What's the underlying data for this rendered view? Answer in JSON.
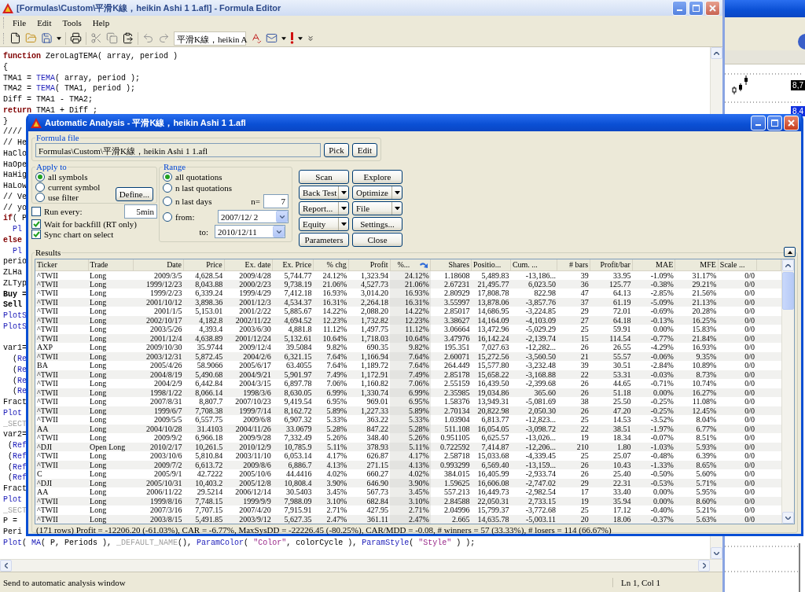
{
  "editor": {
    "title": "[Formulas\\Custom\\平滑K線，heikin Ashi 1 1.afl] - Formula Editor",
    "menu": [
      "File",
      "Edit",
      "Tools",
      "Help"
    ],
    "toolbar_combo": "平滑K線，heikin A",
    "code_lines": [
      {
        "segments": [
          {
            "kind": "keyword",
            "text": "function"
          },
          {
            "kind": "plain",
            "text": " ZeroLagTEMA( array, period )"
          }
        ]
      },
      {
        "segments": [
          {
            "kind": "plain",
            "text": "{"
          }
        ]
      },
      {
        "segments": [
          {
            "kind": "plain",
            "text": "TMA1 = "
          },
          {
            "kind": "func",
            "text": "TEMA"
          },
          {
            "kind": "plain",
            "text": "( array, period );"
          }
        ]
      },
      {
        "segments": [
          {
            "kind": "plain",
            "text": "TMA2 = "
          },
          {
            "kind": "func",
            "text": "TEMA"
          },
          {
            "kind": "plain",
            "text": "( TMA1, period );"
          }
        ]
      },
      {
        "segments": [
          {
            "kind": "plain",
            "text": "Diff = TMA1 - TMA2;"
          }
        ]
      },
      {
        "segments": [
          {
            "kind": "keyword",
            "text": "return"
          },
          {
            "kind": "plain",
            "text": " TMA1 + Diff ;"
          }
        ]
      },
      {
        "segments": [
          {
            "kind": "plain",
            "text": "}"
          }
        ]
      },
      {
        "segments": [
          {
            "kind": "plain",
            "text": "////"
          }
        ]
      },
      {
        "segments": [
          {
            "kind": "plain",
            "text": "// He"
          }
        ]
      },
      {
        "segments": [
          {
            "kind": "plain",
            "text": "HaClo"
          }
        ]
      },
      {
        "segments": [
          {
            "kind": "plain",
            "text": "HaOpe"
          }
        ]
      },
      {
        "segments": [
          {
            "kind": "plain",
            "text": "HaHig"
          }
        ]
      },
      {
        "segments": [
          {
            "kind": "plain",
            "text": "HaLow"
          }
        ]
      },
      {
        "segments": [
          {
            "kind": "plain",
            "text": "// Ve"
          }
        ]
      },
      {
        "segments": [
          {
            "kind": "plain",
            "text": "// yo"
          }
        ]
      },
      {
        "segments": [
          {
            "kind": "keyword",
            "text": "if"
          },
          {
            "kind": "plain",
            "text": "( P"
          }
        ]
      },
      {
        "indented": true,
        "segments": [
          {
            "kind": "func",
            "text": "Pl"
          }
        ]
      },
      {
        "segments": [
          {
            "kind": "keyword",
            "text": "else"
          }
        ]
      },
      {
        "indented": true,
        "segments": [
          {
            "kind": "func",
            "text": "Pl"
          }
        ]
      },
      {
        "segments": [
          {
            "kind": "plain",
            "text": "perio"
          }
        ]
      },
      {
        "segments": [
          {
            "kind": "plain",
            "text": "ZLHa"
          }
        ]
      },
      {
        "segments": [
          {
            "kind": "plain",
            "text": "ZLTyp"
          }
        ]
      },
      {
        "segments": [
          {
            "kind": "bold",
            "text": "Buy ="
          }
        ]
      },
      {
        "segments": [
          {
            "kind": "bold",
            "text": "Sell"
          }
        ]
      },
      {
        "segments": [
          {
            "kind": "func",
            "text": "PlotS"
          }
        ]
      },
      {
        "segments": [
          {
            "kind": "func",
            "text": "PlotS"
          }
        ]
      },
      {
        "kind": "blank"
      },
      {
        "segments": [
          {
            "kind": "plain",
            "text": "var1="
          }
        ]
      },
      {
        "segments": [
          {
            "kind": "plain",
            "text": "  ("
          },
          {
            "kind": "func",
            "text": "Re"
          }
        ]
      },
      {
        "segments": [
          {
            "kind": "plain",
            "text": "  ("
          },
          {
            "kind": "func",
            "text": "Re"
          }
        ]
      },
      {
        "segments": [
          {
            "kind": "plain",
            "text": "  ("
          },
          {
            "kind": "func",
            "text": "Re"
          }
        ]
      },
      {
        "segments": [
          {
            "kind": "plain",
            "text": "  ("
          },
          {
            "kind": "func",
            "text": "Re"
          }
        ]
      },
      {
        "segments": [
          {
            "kind": "plain",
            "text": "Fract"
          }
        ]
      },
      {
        "segments": [
          {
            "kind": "func",
            "text": "Plot"
          }
        ]
      },
      {
        "segments": [
          {
            "kind": "muted",
            "text": "_SECT"
          }
        ]
      },
      {
        "segments": [
          {
            "kind": "plain",
            "text": "var2="
          }
        ]
      },
      {
        "segments": [
          {
            "kind": "plain",
            "text": " ("
          },
          {
            "kind": "func",
            "text": "Ref"
          }
        ]
      },
      {
        "segments": [
          {
            "kind": "plain",
            "text": " ("
          },
          {
            "kind": "func",
            "text": "Ref"
          }
        ]
      },
      {
        "segments": [
          {
            "kind": "plain",
            "text": " ("
          },
          {
            "kind": "func",
            "text": "Ref"
          }
        ]
      },
      {
        "segments": [
          {
            "kind": "plain",
            "text": " ("
          },
          {
            "kind": "func",
            "text": "Ref"
          }
        ]
      },
      {
        "segments": [
          {
            "kind": "plain",
            "text": "Fract"
          }
        ]
      },
      {
        "segments": [
          {
            "kind": "func",
            "text": "Plot"
          }
        ]
      },
      {
        "segments": [
          {
            "kind": "muted",
            "text": "_SECT"
          }
        ]
      },
      {
        "segments": [
          {
            "kind": "plain",
            "text": "P = "
          }
        ]
      },
      {
        "segments": [
          {
            "kind": "plain",
            "text": "Peri"
          }
        ]
      },
      {
        "segments": [
          {
            "kind": "func",
            "text": "Plot"
          },
          {
            "kind": "plain",
            "text": "( "
          },
          {
            "kind": "func",
            "text": "MA"
          },
          {
            "kind": "plain",
            "text": "( P, Periods ), "
          },
          {
            "kind": "muted",
            "text": "_DEFAULT_NAME"
          },
          {
            "kind": "plain",
            "text": "(), "
          },
          {
            "kind": "func",
            "text": "ParamColor"
          },
          {
            "kind": "plain",
            "text": "( "
          },
          {
            "kind": "string",
            "text": "\"Color\""
          },
          {
            "kind": "plain",
            "text": ", colorCycle ), "
          },
          {
            "kind": "func",
            "text": "ParamStyle"
          },
          {
            "kind": "plain",
            "text": "( "
          },
          {
            "kind": "string",
            "text": "\"Style\""
          },
          {
            "kind": "plain",
            "text": " ) );"
          }
        ]
      }
    ],
    "status": "Send to automatic analysis window",
    "position": "Ln 1, Col 1"
  },
  "chart_panel": {
    "price_labels": [
      {
        "text": "8,7",
        "kind": "last"
      },
      {
        "text": "8,4",
        "kind": "current"
      }
    ]
  },
  "dialog": {
    "title": "Automatic Analysis - 平滑K線，heikin Ashi 1 1.afl",
    "formula_file": {
      "label": "Formula file",
      "value": "Formulas\\Custom\\平滑K線，heikin Ashi 1 1.afl",
      "buttons": [
        "Pick",
        "Edit"
      ]
    },
    "apply_to": {
      "label": "Apply to",
      "options": [
        {
          "label": "all symbols",
          "selected": true
        },
        {
          "label": "current symbol",
          "selected": false
        },
        {
          "label": "use filter",
          "selected": false
        }
      ],
      "define_button": "Define..."
    },
    "run_every": {
      "label": "Run every:",
      "checked": false,
      "value": "5min"
    },
    "checkboxes": [
      {
        "label": "Wait for backfill (RT only)",
        "checked": true
      },
      {
        "label": "Sync chart on select",
        "checked": true
      }
    ],
    "range": {
      "label": "Range",
      "options": [
        {
          "label": "all quotations",
          "selected": true
        },
        {
          "label": "n last quotations",
          "selected": false
        },
        {
          "label": "n last days",
          "selected": false
        },
        {
          "label": "from:",
          "selected": false
        }
      ],
      "n_label": "n=",
      "n_value": "7",
      "from_date": "2007/12/ 2",
      "to_label": "to:",
      "to_date": "2010/12/11"
    },
    "actions": [
      {
        "label": "Scan",
        "dropdown": false
      },
      {
        "label": "Explore",
        "dropdown": false
      },
      {
        "label": "Back Test",
        "dropdown": true
      },
      {
        "label": "Optimize",
        "dropdown": true
      },
      {
        "label": "Report...",
        "dropdown": true
      },
      {
        "label": "File",
        "dropdown": true
      },
      {
        "label": "Equity",
        "dropdown": true
      },
      {
        "label": "Settings...",
        "dropdown": false
      },
      {
        "label": "Parameters",
        "dropdown": false
      },
      {
        "label": "Close",
        "dropdown": false
      }
    ],
    "results": {
      "label": "Results",
      "columns": [
        {
          "label": "Ticker",
          "sorted": false
        },
        {
          "label": "Trade",
          "sorted": false
        },
        {
          "label": "Date",
          "sorted": false
        },
        {
          "label": "Price",
          "sorted": false
        },
        {
          "label": "Ex. date",
          "sorted": false
        },
        {
          "label": "Ex. Price",
          "sorted": false
        },
        {
          "label": "% chg",
          "sorted": false
        },
        {
          "label": "Profit",
          "sorted": false
        },
        {
          "label": "%...",
          "sorted": true
        },
        {
          "label": "Shares",
          "sorted": false
        },
        {
          "label": "Positio...",
          "sorted": false
        },
        {
          "label": "Cum. ...",
          "sorted": false
        },
        {
          "label": "# bars",
          "sorted": false
        },
        {
          "label": "Profit/bar",
          "sorted": false
        },
        {
          "label": "MAE",
          "sorted": false
        },
        {
          "label": "MFE",
          "sorted": false
        },
        {
          "label": "Scale ...",
          "sorted": false
        }
      ],
      "rows": [
        [
          "^TWII",
          "Long",
          "2009/3/5",
          "4,628.54",
          "2009/4/28",
          "5,744.77",
          "24.12%",
          "1,323.94",
          "24.12%",
          "1.18608",
          "5,489.83",
          "-13,186...",
          "39",
          "33.95",
          "-1.09%",
          "31.17%",
          "0/0"
        ],
        [
          "^TWII",
          "Long",
          "1999/12/23",
          "8,043.88",
          "2000/2/23",
          "9,738.19",
          "21.06%",
          "4,527.73",
          "21.06%",
          "2.67231",
          "21,495.77",
          "6,023.50",
          "36",
          "125.77",
          "-0.38%",
          "29.21%",
          "0/0"
        ],
        [
          "^TWII",
          "Long",
          "1999/2/23",
          "6,339.24",
          "1999/4/29",
          "7,412.18",
          "16.93%",
          "3,014.20",
          "16.93%",
          "2.80929",
          "17,808.78",
          "822.98",
          "47",
          "64.13",
          "-2.85%",
          "21.56%",
          "0/0"
        ],
        [
          "^TWII",
          "Long",
          "2001/10/12",
          "3,898.36",
          "2001/12/3",
          "4,534.37",
          "16.31%",
          "2,264.18",
          "16.31%",
          "3.55997",
          "13,878.06",
          "-3,857.76",
          "37",
          "61.19",
          "-5.09%",
          "21.13%",
          "0/0"
        ],
        [
          "^TWII",
          "Long",
          "2001/1/5",
          "5,153.01",
          "2001/2/22",
          "5,885.67",
          "14.22%",
          "2,088.20",
          "14.22%",
          "2.85017",
          "14,686.95",
          "-3,224.85",
          "29",
          "72.01",
          "-0.69%",
          "20.28%",
          "0/0"
        ],
        [
          "^TWII",
          "Long",
          "2002/10/17",
          "4,182.8",
          "2002/11/22",
          "4,694.52",
          "12.23%",
          "1,732.82",
          "12.23%",
          "3.38627",
          "14,164.09",
          "-4,103.09",
          "27",
          "64.18",
          "-0.13%",
          "16.25%",
          "0/0"
        ],
        [
          "^TWII",
          "Long",
          "2003/5/26",
          "4,393.4",
          "2003/6/30",
          "4,881.8",
          "11.12%",
          "1,497.75",
          "11.12%",
          "3.06664",
          "13,472.96",
          "-5,029.29",
          "25",
          "59.91",
          "0.00%",
          "15.83%",
          "0/0"
        ],
        [
          "^TWII",
          "Long",
          "2001/12/4",
          "4,638.89",
          "2001/12/24",
          "5,132.61",
          "10.64%",
          "1,718.03",
          "10.64%",
          "3.47976",
          "16,142.24",
          "-2,139.74",
          "15",
          "114.54",
          "-0.77%",
          "21.84%",
          "0/0"
        ],
        [
          "AXP",
          "Long",
          "2009/10/30",
          "35.9744",
          "2009/12/4",
          "39.5084",
          "9.82%",
          "690.35",
          "9.82%",
          "195.351",
          "7,027.63",
          "-12,282...",
          "26",
          "26.55",
          "-4.29%",
          "16.93%",
          "0/0"
        ],
        [
          "^TWII",
          "Long",
          "2003/12/31",
          "5,872.45",
          "2004/2/6",
          "6,321.15",
          "7.64%",
          "1,166.94",
          "7.64%",
          "2.60071",
          "15,272.56",
          "-3,560.50",
          "21",
          "55.57",
          "-0.06%",
          "9.35%",
          "0/0"
        ],
        [
          "BA",
          "Long",
          "2005/4/26",
          "58.9066",
          "2005/6/17",
          "63.4055",
          "7.64%",
          "1,189.72",
          "7.64%",
          "264.449",
          "15,577.80",
          "-3,232.48",
          "39",
          "30.51",
          "-2.84%",
          "10.89%",
          "0/0"
        ],
        [
          "^TWII",
          "Long",
          "2004/8/19",
          "5,490.68",
          "2004/9/21",
          "5,901.97",
          "7.49%",
          "1,172.91",
          "7.49%",
          "2.85178",
          "15,658.22",
          "-3,168.88",
          "22",
          "53.31",
          "-0.03%",
          "8.73%",
          "0/0"
        ],
        [
          "^TWII",
          "Long",
          "2004/2/9",
          "6,442.84",
          "2004/3/15",
          "6,897.78",
          "7.06%",
          "1,160.82",
          "7.06%",
          "2.55159",
          "16,439.50",
          "-2,399.68",
          "26",
          "44.65",
          "-0.71%",
          "10.74%",
          "0/0"
        ],
        [
          "^TWII",
          "Long",
          "1998/1/22",
          "8,066.14",
          "1998/3/6",
          "8,630.05",
          "6.99%",
          "1,330.74",
          "6.99%",
          "2.35985",
          "19,034.86",
          "365.60",
          "26",
          "51.18",
          "0.00%",
          "16.27%",
          "0/0"
        ],
        [
          "^TWII",
          "Long",
          "2007/8/31",
          "8,807.7",
          "2007/10/23",
          "9,419.54",
          "6.95%",
          "969.01",
          "6.95%",
          "1.58376",
          "13,949.31",
          "-5,081.69",
          "38",
          "25.50",
          "-0.25%",
          "11.08%",
          "0/0"
        ],
        [
          "^TWII",
          "Long",
          "1999/6/7",
          "7,708.38",
          "1999/7/14",
          "8,162.72",
          "5.89%",
          "1,227.33",
          "5.89%",
          "2.70134",
          "20,822.98",
          "2,050.30",
          "26",
          "47.20",
          "-0.25%",
          "12.45%",
          "0/0"
        ],
        [
          "^TWII",
          "Long",
          "2009/5/5",
          "6,557.75",
          "2009/6/8",
          "6,907.32",
          "5.33%",
          "363.22",
          "5.33%",
          "1.03904",
          "6,813.77",
          "-12,823...",
          "25",
          "14.53",
          "-3.52%",
          "8.04%",
          "0/0"
        ],
        [
          "AA",
          "Long",
          "2004/10/28",
          "31.4103",
          "2004/11/26",
          "33.0679",
          "5.28%",
          "847.22",
          "5.28%",
          "511.108",
          "16,054.05",
          "-3,098.72",
          "22",
          "38.51",
          "-1.97%",
          "6.77%",
          "0/0"
        ],
        [
          "^TWII",
          "Long",
          "2009/9/2",
          "6,966.18",
          "2009/9/28",
          "7,332.49",
          "5.26%",
          "348.40",
          "5.26%",
          "0.951105",
          "6,625.57",
          "-13,026...",
          "19",
          "18.34",
          "-0.07%",
          "8.51%",
          "0/0"
        ],
        [
          "^DJI",
          "Open Long",
          "2010/2/17",
          "10,261.5",
          "2010/12/9",
          "10,785.9",
          "5.11%",
          "378.93",
          "5.11%",
          "0.722592",
          "7,414.87",
          "-12,206...",
          "210",
          "1.80",
          "-1.03%",
          "5.93%",
          "0/0"
        ],
        [
          "^TWII",
          "Long",
          "2003/10/6",
          "5,810.84",
          "2003/11/10",
          "6,053.14",
          "4.17%",
          "626.87",
          "4.17%",
          "2.58718",
          "15,033.68",
          "-4,339.45",
          "25",
          "25.07",
          "-0.48%",
          "6.39%",
          "0/0"
        ],
        [
          "^TWII",
          "Long",
          "2009/7/2",
          "6,613.72",
          "2009/8/6",
          "6,886.7",
          "4.13%",
          "271.15",
          "4.13%",
          "0.993299",
          "6,569.40",
          "-13,159...",
          "26",
          "10.43",
          "-1.33%",
          "8.65%",
          "0/0"
        ],
        [
          "C",
          "Long",
          "2005/9/1",
          "42.7222",
          "2005/10/6",
          "44.4416",
          "4.02%",
          "660.27",
          "4.02%",
          "384.015",
          "16,405.99",
          "-2,933.74",
          "26",
          "25.40",
          "-0.50%",
          "5.60%",
          "0/0"
        ],
        [
          "^DJI",
          "Long",
          "2005/10/31",
          "10,403.2",
          "2005/12/8",
          "10,808.4",
          "3.90%",
          "646.90",
          "3.90%",
          "1.59625",
          "16,606.08",
          "-2,747.02",
          "29",
          "22.31",
          "-0.53%",
          "5.71%",
          "0/0"
        ],
        [
          "AA",
          "Long",
          "2006/11/22",
          "29.5214",
          "2006/12/14",
          "30.5403",
          "3.45%",
          "567.73",
          "3.45%",
          "557.213",
          "16,449.73",
          "-2,982.54",
          "17",
          "33.40",
          "0.00%",
          "5.95%",
          "0/0"
        ],
        [
          "^TWII",
          "Long",
          "1999/8/16",
          "7,748.15",
          "1999/9/9",
          "7,988.09",
          "3.10%",
          "682.84",
          "3.10%",
          "2.84588",
          "22,050.31",
          "2,733.15",
          "19",
          "35.94",
          "0.00%",
          "8.60%",
          "0/0"
        ],
        [
          "^TWII",
          "Long",
          "2007/3/16",
          "7,707.15",
          "2007/4/20",
          "7,915.91",
          "2.71%",
          "427.95",
          "2.71%",
          "2.04996",
          "15,799.37",
          "-3,772.68",
          "25",
          "17.12",
          "-0.40%",
          "5.21%",
          "0/0"
        ],
        [
          "^TWII",
          "Long",
          "2003/8/15",
          "5,491.85",
          "2003/9/12",
          "5,627.35",
          "2.47%",
          "361.11",
          "2.47%",
          "2.665",
          "14,635.78",
          "-5,003.11",
          "20",
          "18.06",
          "-0.37%",
          "5.63%",
          "0/0"
        ]
      ],
      "summary": "(171 rows) Profit = -12206.20 (-61.03%), CAR = -6.77%, MaxSysDD = -22226.45 (-80.25%), CAR/MDD = -0.08, # winners = 57 (33.33%), # losers = 114 (66.67%)"
    }
  }
}
